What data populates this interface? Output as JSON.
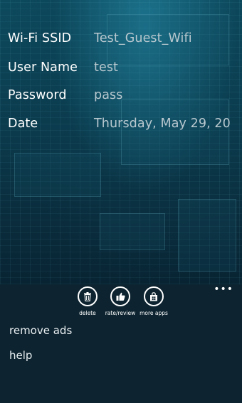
{
  "fields": [
    {
      "label": "Wi-Fi SSID",
      "value": "Test_Guest_Wifi"
    },
    {
      "label": "User Name",
      "value": "test"
    },
    {
      "label": "Password",
      "value": "pass"
    },
    {
      "label": "Date",
      "value": "Thursday, May 29, 20"
    }
  ],
  "appbar": {
    "buttons": [
      {
        "label": "delete",
        "icon": "trash-icon"
      },
      {
        "label": "rate/review",
        "icon": "thumbs-up-icon"
      },
      {
        "label": "more apps",
        "icon": "store-icon"
      }
    ],
    "more": "•••",
    "menu": [
      "remove ads",
      "help"
    ]
  }
}
